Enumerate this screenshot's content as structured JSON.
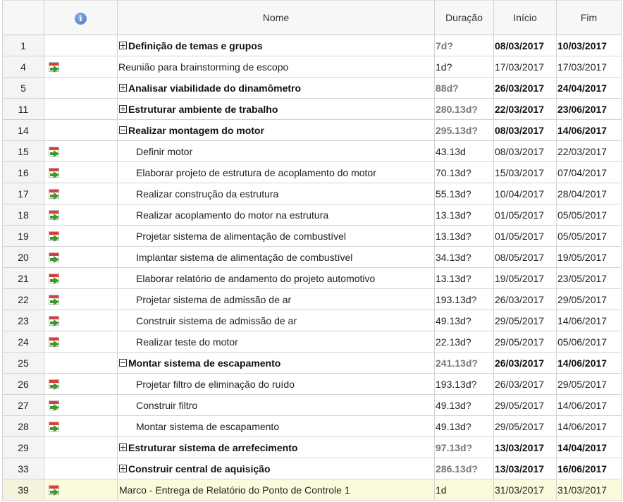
{
  "header": {
    "info_icon": "info-icon",
    "name": "Nome",
    "duration": "Duração",
    "start": "Início",
    "end": "Fim"
  },
  "rows": [
    {
      "id": "1",
      "type": "summary",
      "toggle": "plus",
      "icon": "",
      "name": "Definição de temas e grupos",
      "duration": "7d?",
      "start": "08/03/2017",
      "end": "10/03/2017"
    },
    {
      "id": "4",
      "type": "top",
      "toggle": "",
      "icon": "calendar-task-icon",
      "name": "Reunião para brainstorming de escopo",
      "duration": "1d?",
      "start": "17/03/2017",
      "end": "17/03/2017"
    },
    {
      "id": "5",
      "type": "summary",
      "toggle": "plus",
      "icon": "",
      "name": "Analisar viabilidade do dinamômetro",
      "duration": "88d?",
      "start": "26/03/2017",
      "end": "24/04/2017"
    },
    {
      "id": "11",
      "type": "summary",
      "toggle": "plus",
      "icon": "",
      "name": "Estruturar ambiente de trabalho",
      "duration": "280.13d?",
      "start": "22/03/2017",
      "end": "23/06/2017"
    },
    {
      "id": "14",
      "type": "summary",
      "toggle": "minus",
      "icon": "",
      "name": "Realizar montagem do motor",
      "duration": "295.13d?",
      "start": "08/03/2017",
      "end": "14/06/2017"
    },
    {
      "id": "15",
      "type": "task",
      "toggle": "",
      "icon": "calendar-task-icon",
      "name": "Definir motor",
      "duration": "43.13d",
      "start": "08/03/2017",
      "end": "22/03/2017"
    },
    {
      "id": "16",
      "type": "task",
      "toggle": "",
      "icon": "calendar-task-icon",
      "name": "Elaborar projeto de estrutura de acoplamento do motor",
      "duration": "70.13d?",
      "start": "15/03/2017",
      "end": "07/04/2017"
    },
    {
      "id": "17",
      "type": "task",
      "toggle": "",
      "icon": "calendar-task-icon",
      "name": "Realizar construção da estrutura",
      "duration": "55.13d?",
      "start": "10/04/2017",
      "end": "28/04/2017"
    },
    {
      "id": "18",
      "type": "task",
      "toggle": "",
      "icon": "calendar-task-icon",
      "name": "Realizar acoplamento do motor na estrutura",
      "duration": "13.13d?",
      "start": "01/05/2017",
      "end": "05/05/2017"
    },
    {
      "id": "19",
      "type": "task",
      "toggle": "",
      "icon": "calendar-task-icon",
      "name": "Projetar sistema de alimentação de combustível",
      "duration": "13.13d?",
      "start": "01/05/2017",
      "end": "05/05/2017"
    },
    {
      "id": "20",
      "type": "task",
      "toggle": "",
      "icon": "calendar-task-icon",
      "name": "Implantar sistema de alimentação de combustível",
      "duration": "34.13d?",
      "start": "08/05/2017",
      "end": "19/05/2017"
    },
    {
      "id": "21",
      "type": "task",
      "toggle": "",
      "icon": "calendar-task-icon",
      "name": "Elaborar relatório de andamento do projeto automotivo",
      "duration": "13.13d?",
      "start": "19/05/2017",
      "end": "23/05/2017"
    },
    {
      "id": "22",
      "type": "task",
      "toggle": "",
      "icon": "calendar-task-icon",
      "name": "Projetar sistema de admissão de ar",
      "duration": "193.13d?",
      "start": "26/03/2017",
      "end": "29/05/2017"
    },
    {
      "id": "23",
      "type": "task",
      "toggle": "",
      "icon": "calendar-task-icon",
      "name": "Construir sistema de admissão de ar",
      "duration": "49.13d?",
      "start": "29/05/2017",
      "end": "14/06/2017"
    },
    {
      "id": "24",
      "type": "task",
      "toggle": "",
      "icon": "calendar-task-icon",
      "name": "Realizar teste do motor",
      "duration": "22.13d?",
      "start": "29/05/2017",
      "end": "05/06/2017"
    },
    {
      "id": "25",
      "type": "summary",
      "toggle": "minus",
      "icon": "",
      "name": "Montar sistema de escapamento",
      "duration": "241.13d?",
      "start": "26/03/2017",
      "end": "14/06/2017"
    },
    {
      "id": "26",
      "type": "task",
      "toggle": "",
      "icon": "calendar-task-icon",
      "name": "Projetar filtro de eliminação do ruído",
      "duration": "193.13d?",
      "start": "26/03/2017",
      "end": "29/05/2017"
    },
    {
      "id": "27",
      "type": "task",
      "toggle": "",
      "icon": "calendar-task-icon",
      "name": "Construir filtro",
      "duration": "49.13d?",
      "start": "29/05/2017",
      "end": "14/06/2017"
    },
    {
      "id": "28",
      "type": "task",
      "toggle": "",
      "icon": "calendar-task-icon",
      "name": "Montar sistema de escapamento",
      "duration": "49.13d?",
      "start": "29/05/2017",
      "end": "14/06/2017"
    },
    {
      "id": "29",
      "type": "summary",
      "toggle": "plus",
      "icon": "",
      "name": "Estruturar sistema de arrefecimento",
      "duration": "97.13d?",
      "start": "13/03/2017",
      "end": "14/04/2017"
    },
    {
      "id": "33",
      "type": "summary",
      "toggle": "plus",
      "icon": "",
      "name": "Construir central de aquisição",
      "duration": "286.13d?",
      "start": "13/03/2017",
      "end": "16/06/2017"
    },
    {
      "id": "39",
      "type": "milestone",
      "toggle": "",
      "icon": "calendar-task-icon",
      "name": "Marco - Entrega de Relatório do Ponto de Controle 1",
      "duration": "1d",
      "start": "31/03/2017",
      "end": "31/03/2017"
    }
  ],
  "colors": {
    "grid_border": "#d4d4d4",
    "milestone_highlight": "#fbfbdc",
    "summary_duration_text": "#777777"
  }
}
